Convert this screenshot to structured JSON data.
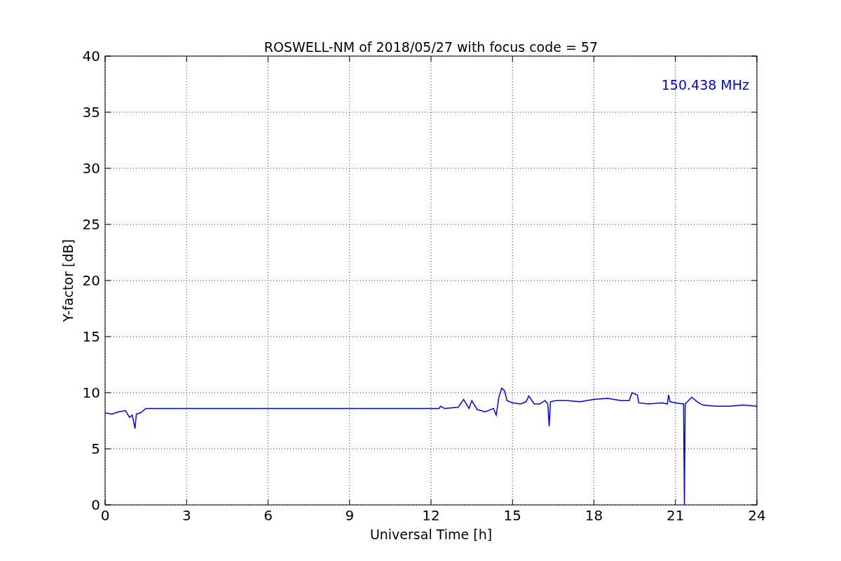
{
  "figure": {
    "chart_data": {
      "type": "line",
      "title": "ROSWELL-NM of 2018/05/27 with focus code = 57",
      "xlabel": "Universal Time [h]",
      "ylabel": "Y-factor [dB]",
      "xlim": [
        0,
        24
      ],
      "ylim": [
        0,
        40
      ],
      "xticks": [
        0,
        3,
        6,
        9,
        12,
        15,
        18,
        21,
        24
      ],
      "yticks": [
        0,
        5,
        10,
        15,
        20,
        25,
        30,
        35,
        40
      ],
      "x": [
        0,
        0.25,
        0.5,
        0.75,
        0.9,
        1.0,
        1.1,
        1.15,
        1.3,
        1.5,
        12.3,
        12.35,
        12.5,
        13.0,
        13.2,
        13.4,
        13.5,
        13.7,
        14.0,
        14.3,
        14.4,
        14.5,
        14.6,
        14.7,
        14.8,
        15.0,
        15.3,
        15.5,
        15.6,
        15.8,
        16.0,
        16.2,
        16.3,
        16.35,
        16.4,
        16.6,
        17.0,
        17.5,
        18.0,
        18.5,
        19.0,
        19.3,
        19.4,
        19.6,
        19.65,
        20.0,
        20.5,
        20.7,
        20.75,
        20.8,
        21.0,
        21.3,
        21.33,
        21.36,
        21.6,
        21.8,
        22.0,
        22.5,
        23.0,
        23.5,
        24.0
      ],
      "series": [
        {
          "name": "150.438 MHz",
          "color": "#0000ff",
          "values": [
            8.2,
            8.1,
            8.3,
            8.4,
            7.8,
            8.0,
            6.8,
            8.1,
            8.2,
            8.6,
            8.6,
            8.8,
            8.6,
            8.7,
            9.4,
            8.6,
            9.3,
            8.5,
            8.3,
            8.6,
            8.0,
            9.6,
            10.4,
            10.2,
            9.3,
            9.1,
            9.0,
            9.2,
            9.7,
            9.0,
            9.0,
            9.3,
            9.0,
            7.0,
            9.2,
            9.3,
            9.3,
            9.2,
            9.4,
            9.5,
            9.3,
            9.3,
            10.0,
            9.8,
            9.1,
            9.0,
            9.1,
            9.0,
            9.8,
            9.2,
            9.1,
            9.0,
            0,
            9.0,
            9.6,
            9.2,
            8.9,
            8.8,
            8.8,
            8.9,
            8.8
          ]
        }
      ],
      "grid": true
    }
  }
}
